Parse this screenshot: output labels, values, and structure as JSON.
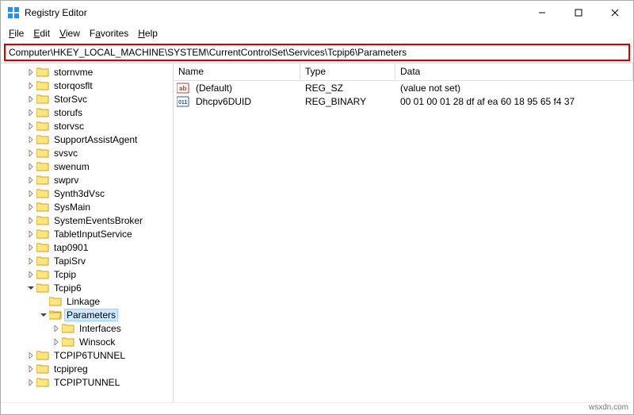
{
  "window": {
    "title": "Registry Editor",
    "minimize": "—",
    "maximize": "☐",
    "close": "✕"
  },
  "menu": {
    "file": "File",
    "edit": "Edit",
    "view": "View",
    "favorites": "Favorites",
    "help": "Help"
  },
  "address": "Computer\\HKEY_LOCAL_MACHINE\\SYSTEM\\CurrentControlSet\\Services\\Tcpip6\\Parameters",
  "tree": [
    {
      "indent": 2,
      "caret": "right",
      "label": "stornvme"
    },
    {
      "indent": 2,
      "caret": "right",
      "label": "storqosflt"
    },
    {
      "indent": 2,
      "caret": "right",
      "label": "StorSvc"
    },
    {
      "indent": 2,
      "caret": "right",
      "label": "storufs"
    },
    {
      "indent": 2,
      "caret": "right",
      "label": "storvsc"
    },
    {
      "indent": 2,
      "caret": "right",
      "label": "SupportAssistAgent"
    },
    {
      "indent": 2,
      "caret": "right",
      "label": "svsvc"
    },
    {
      "indent": 2,
      "caret": "right",
      "label": "swenum"
    },
    {
      "indent": 2,
      "caret": "right",
      "label": "swprv"
    },
    {
      "indent": 2,
      "caret": "right",
      "label": "Synth3dVsc"
    },
    {
      "indent": 2,
      "caret": "right",
      "label": "SysMain"
    },
    {
      "indent": 2,
      "caret": "right",
      "label": "SystemEventsBroker"
    },
    {
      "indent": 2,
      "caret": "right",
      "label": "TabletInputService"
    },
    {
      "indent": 2,
      "caret": "right",
      "label": "tap0901"
    },
    {
      "indent": 2,
      "caret": "right",
      "label": "TapiSrv"
    },
    {
      "indent": 2,
      "caret": "right",
      "label": "Tcpip"
    },
    {
      "indent": 2,
      "caret": "down",
      "label": "Tcpip6"
    },
    {
      "indent": 3,
      "caret": "none",
      "label": "Linkage"
    },
    {
      "indent": 3,
      "caret": "down",
      "label": "Parameters",
      "selected": true,
      "open": true
    },
    {
      "indent": 4,
      "caret": "right",
      "label": "Interfaces"
    },
    {
      "indent": 4,
      "caret": "right",
      "label": "Winsock"
    },
    {
      "indent": 2,
      "caret": "right",
      "label": "TCPIP6TUNNEL"
    },
    {
      "indent": 2,
      "caret": "right",
      "label": "tcpipreg"
    },
    {
      "indent": 2,
      "caret": "right",
      "label": "TCPIPTUNNEL"
    }
  ],
  "list": {
    "headers": {
      "name": "Name",
      "type": "Type",
      "data": "Data"
    },
    "rows": [
      {
        "icon": "string",
        "name": "(Default)",
        "type": "REG_SZ",
        "data": "(value not set)"
      },
      {
        "icon": "binary",
        "name": "Dhcpv6DUID",
        "type": "REG_BINARY",
        "data": "00 01 00 01 28 df af ea 60 18 95 65 f4 37"
      }
    ]
  },
  "footer": "wsxdn.com"
}
